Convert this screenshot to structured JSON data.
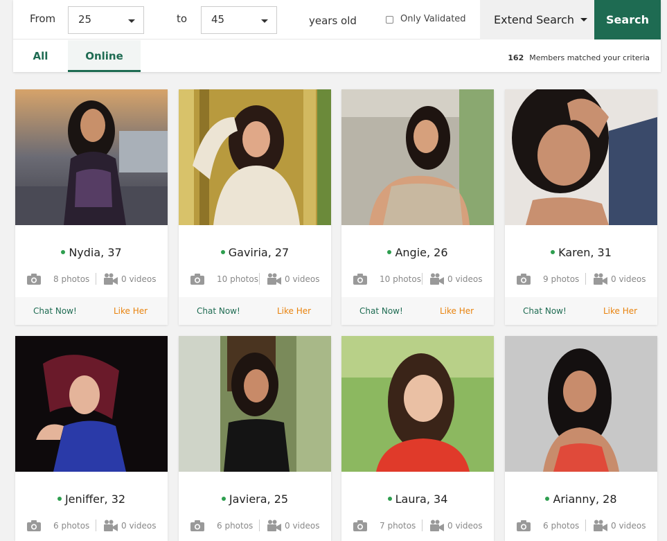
{
  "filters": {
    "from_label": "From",
    "from_value": "25",
    "to_label": "to",
    "to_value": "45",
    "years_label": "years old",
    "validated_label": "Only Validated",
    "validated_checked": false,
    "extend_label": "Extend Search",
    "search_label": "Search"
  },
  "tabs": [
    {
      "label": "All",
      "active": false
    },
    {
      "label": "Online",
      "active": true
    }
  ],
  "match": {
    "count": "162",
    "text": "Members matched your criteria"
  },
  "card_actions": {
    "chat": "Chat Now!",
    "like": "Like Her"
  },
  "colors": {
    "brand": "#1e6b52",
    "online": "#2e9e4f",
    "like": "#e8820c"
  },
  "members": [
    {
      "name": "Nydia, 37",
      "photos": "8 photos",
      "videos": "0 videos"
    },
    {
      "name": "Gaviria, 27",
      "photos": "10 photos",
      "videos": "0 videos"
    },
    {
      "name": "Angie, 26",
      "photos": "10 photos",
      "videos": "0 videos"
    },
    {
      "name": "Karen, 31",
      "photos": "9 photos",
      "videos": "0 videos"
    },
    {
      "name": "Jeniffer, 32",
      "photos": "6 photos",
      "videos": "0 videos"
    },
    {
      "name": "Javiera, 25",
      "photos": "6 photos",
      "videos": "0 videos"
    },
    {
      "name": "Laura, 34",
      "photos": "7 photos",
      "videos": "0 videos"
    },
    {
      "name": "Arianny, 28",
      "photos": "6 photos",
      "videos": "0 videos"
    }
  ]
}
